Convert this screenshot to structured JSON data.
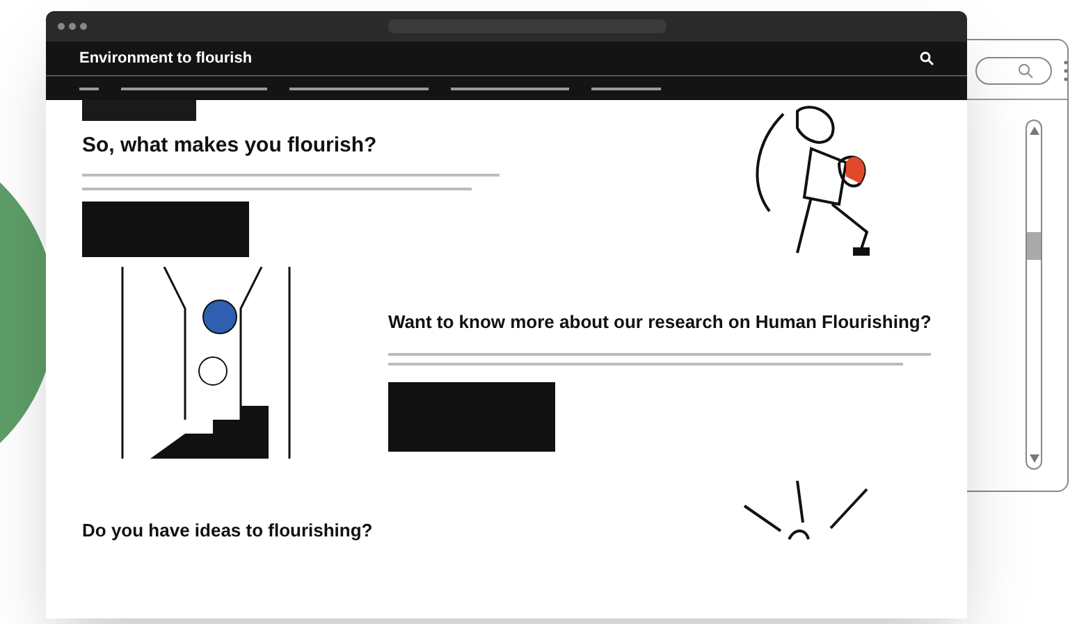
{
  "site_header": {
    "title": "Environment to flourish"
  },
  "sections": [
    {
      "heading": "So, what makes you flourish?"
    },
    {
      "heading": "Want to know more about our research on Human Flourishing?"
    },
    {
      "heading": "Do you have ideas to flourishing?"
    }
  ]
}
